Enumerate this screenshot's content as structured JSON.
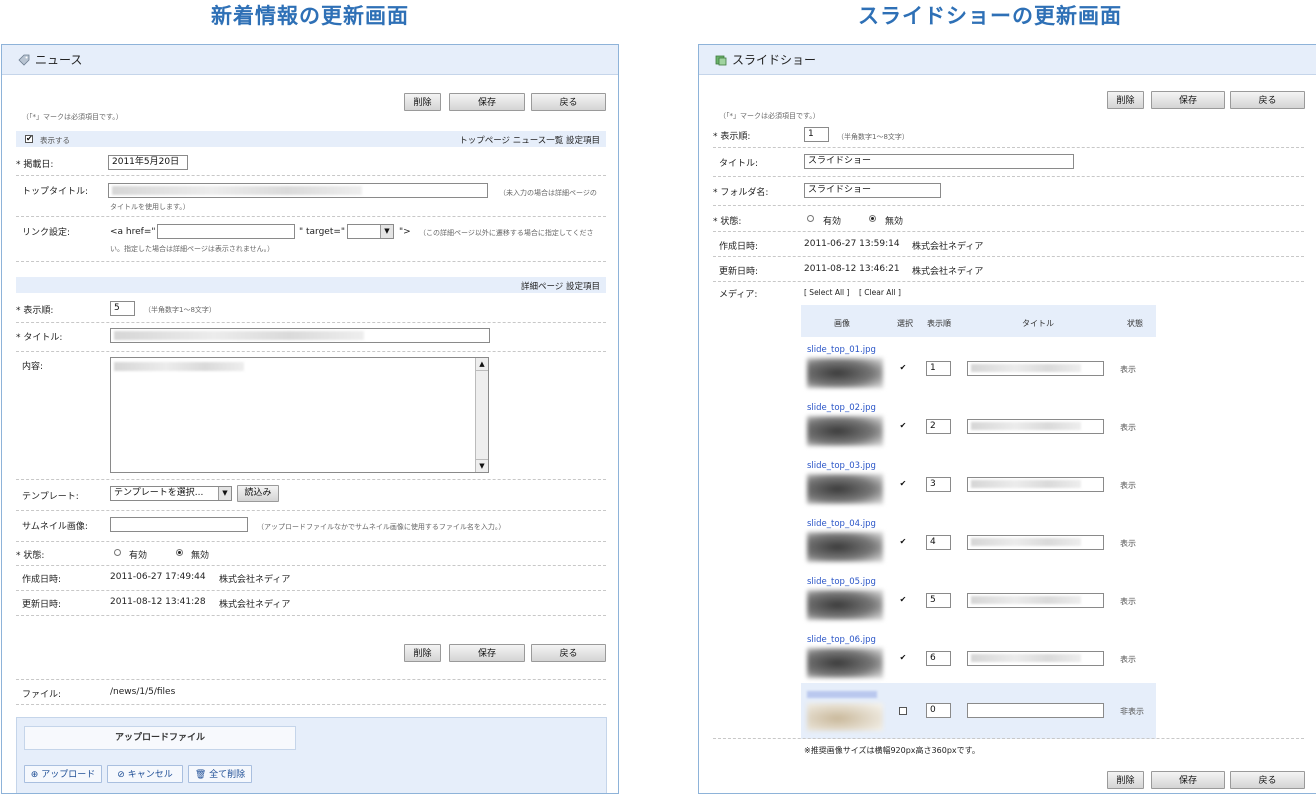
{
  "headings": {
    "news": "新着情報の更新画面",
    "slideshow": "スライドショーの更新画面"
  },
  "news": {
    "panel_title": "ニュース",
    "buttons": {
      "delete": "削除",
      "save": "保存",
      "back": "戻る"
    },
    "required_note": "（「*」マークは必須項目です。）",
    "show_label": "表示する",
    "top_section_title": "トップページ ニュース一覧 設定項目",
    "publish_date_label": "* 掲載日:",
    "publish_date_value": "2011年5月20日",
    "top_title_label": "トップタイトル:",
    "top_title_note_1": "（未入力の場合は詳細ページの",
    "top_title_note_2": "タイトルを使用します。）",
    "link_label": "リンク設定:",
    "link_href": "<a href=\"",
    "link_target": "\" target=\"",
    "link_end": "\">",
    "link_note_1": "（この詳細ページ以外に遷移する場合に指定してくださ",
    "link_note_2": "い。指定した場合は詳細ページは表示されません。）",
    "detail_section_title": "詳細ページ 設定項目",
    "order_label": "* 表示順:",
    "order_value": "5",
    "order_note": "（半角数字1～8文字）",
    "title_label": "* タイトル:",
    "content_label": "内容:",
    "template_label": "テンプレート:",
    "template_select": "テンプレートを選択...",
    "template_load": "読込み",
    "thumb_label": "サムネイル画像:",
    "thumb_note": "（アップロードファイルなかでサムネイル画像に使用するファイル名を入力。）",
    "status_label": "* 状態:",
    "status_on": "有効",
    "status_off": "無効",
    "created_label": "作成日時:",
    "created_value": "2011-06-27 17:49:44",
    "created_by": "株式会社ネディア",
    "updated_label": "更新日時:",
    "updated_value": "2011-08-12 13:41:28",
    "updated_by": "株式会社ネディア",
    "file_label": "ファイル:",
    "file_value": "/news/1/5/files",
    "upload_title": "アップロードファイル",
    "upload_btn": "アップロード",
    "cancel_btn": "キャンセル",
    "delete_all_btn": "全て削除"
  },
  "slideshow": {
    "panel_title": "スライドショー",
    "buttons": {
      "delete": "削除",
      "save": "保存",
      "back": "戻る"
    },
    "required_note": "（「*」マークは必須項目です。）",
    "order_label": "* 表示順:",
    "order_value": "1",
    "order_note": "（半角数字1～8文字）",
    "title_label": "タイトル:",
    "title_value": "スライドショー",
    "folder_label": "* フォルダ名:",
    "folder_value": "スライドショー",
    "status_label": "* 状態:",
    "status_on": "有効",
    "status_off": "無効",
    "created_label": "作成日時:",
    "created_value": "2011-06-27 13:59:14",
    "created_by": "株式会社ネディア",
    "updated_label": "更新日時:",
    "updated_value": "2011-08-12 13:46:21",
    "updated_by": "株式会社ネディア",
    "media_label": "メディア:",
    "select_all": "[ Select All ]",
    "clear_all": "[ Clear All ]",
    "table_headers": {
      "image": "画像",
      "select": "選択",
      "order": "表示順",
      "title": "タイトル",
      "status": "状態"
    },
    "rows": [
      {
        "file": "slide_top_01.jpg",
        "order": "1",
        "checked": "✔",
        "status": "表示"
      },
      {
        "file": "slide_top_02.jpg",
        "order": "2",
        "checked": "✔",
        "status": "表示"
      },
      {
        "file": "slide_top_03.jpg",
        "order": "3",
        "checked": "✔",
        "status": "表示"
      },
      {
        "file": "slide_top_04.jpg",
        "order": "4",
        "checked": "✔",
        "status": "表示"
      },
      {
        "file": "slide_top_05.jpg",
        "order": "5",
        "checked": "✔",
        "status": "表示"
      },
      {
        "file": "slide_top_06.jpg",
        "order": "6",
        "checked": "✔",
        "status": "表示"
      },
      {
        "file": "",
        "order": "0",
        "checked": "",
        "status": "非表示"
      }
    ],
    "size_note": "※推奨画像サイズは横幅920px高さ360pxです。"
  }
}
